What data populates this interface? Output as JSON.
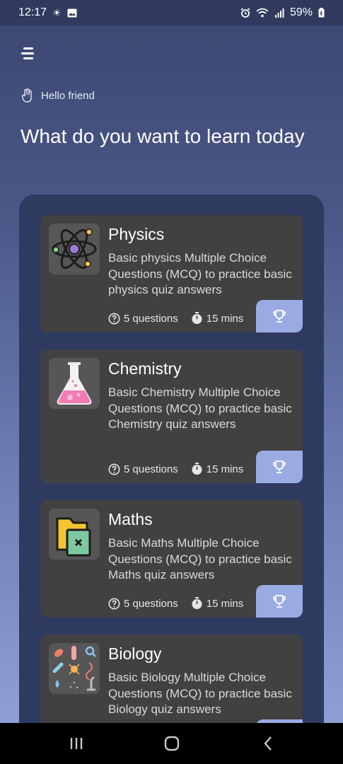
{
  "status_bar": {
    "time": "12:17",
    "battery": "59%",
    "left_icons": [
      "brightness-icon",
      "image-icon"
    ],
    "right_icons": [
      "alarm-icon",
      "wifi-icon",
      "signal-icon",
      "battery-icon"
    ]
  },
  "header": {
    "greeting": "Hello friend",
    "headline": "What do you want to learn today"
  },
  "subjects": [
    {
      "title": "Physics",
      "description": "Basic physics Multiple Choice Questions (MCQ) to practice basic physics quiz answers",
      "questions": "5 questions",
      "duration": "15 mins",
      "icon": "atom-icon"
    },
    {
      "title": "Chemistry",
      "description": "Basic Chemistry Multiple Choice Questions (MCQ) to practice basic Chemistry quiz answers",
      "questions": "5 questions",
      "duration": "15 mins",
      "icon": "flask-icon"
    },
    {
      "title": "Maths",
      "description": "Basic Maths Multiple Choice Questions (MCQ) to practice basic Maths quiz answers",
      "questions": "5 questions",
      "duration": "15 mins",
      "icon": "folder-icon"
    },
    {
      "title": "Biology",
      "description": "Basic Biology Multiple Choice Questions (MCQ) to practice basic Biology quiz answers",
      "icon": "biology-icon"
    }
  ],
  "colors": {
    "panel": "#2e3a5f",
    "card": "#414141",
    "trophy_button": "#9aaae2"
  }
}
